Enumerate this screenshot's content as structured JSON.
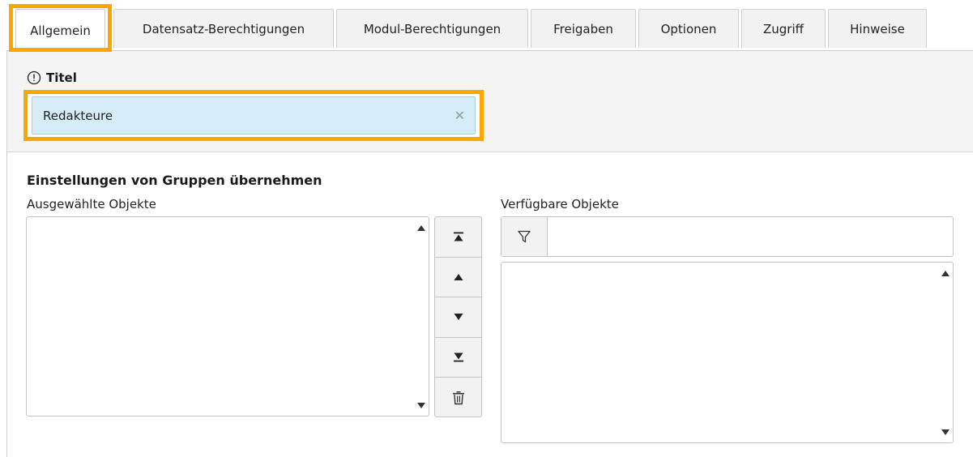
{
  "tabs": [
    {
      "label": "Allgemein",
      "active": true
    },
    {
      "label": "Datensatz-Berechtigungen",
      "active": false
    },
    {
      "label": "Modul-Berechtigungen",
      "active": false
    },
    {
      "label": "Freigaben",
      "active": false
    },
    {
      "label": "Optionen",
      "active": false
    },
    {
      "label": "Zugriff",
      "active": false
    },
    {
      "label": "Hinweise",
      "active": false
    }
  ],
  "title_field": {
    "label": "Titel",
    "value": "Redakteure",
    "icon": "info-icon",
    "clear_icon": "close-icon"
  },
  "inherit_section": {
    "title": "Einstellungen von Gruppen übernehmen",
    "selected_label": "Ausgewählte Objekte",
    "available_label": "Verfügbare Objekte",
    "filter_placeholder": "",
    "filter_icon": "filter-icon",
    "move_buttons": [
      {
        "icon": "move-to-top-icon"
      },
      {
        "icon": "move-up-icon"
      },
      {
        "icon": "move-down-icon"
      },
      {
        "icon": "move-to-bottom-icon"
      },
      {
        "icon": "trash-icon"
      }
    ]
  },
  "colors": {
    "highlight": "#ffa500",
    "input_background": "#d4ecf5",
    "panel_header_background": "#f4f4f4"
  }
}
